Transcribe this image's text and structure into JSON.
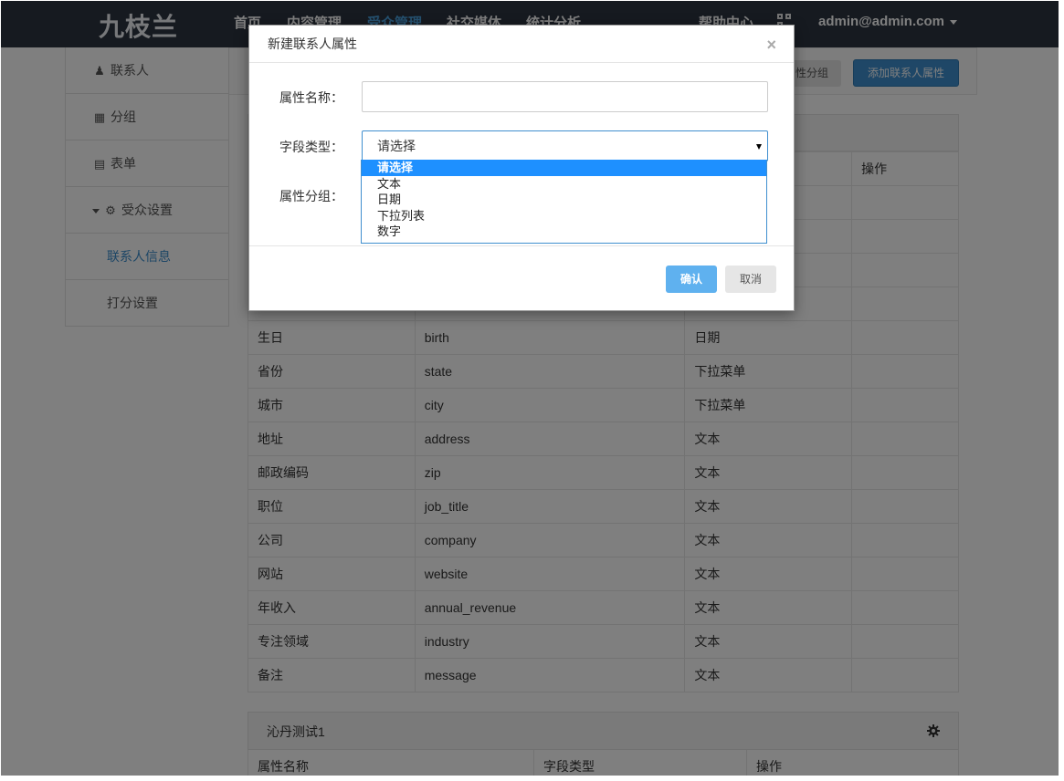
{
  "nav": {
    "logo": "九枝兰",
    "items": [
      "首页",
      "内容管理",
      "受众管理",
      "社交媒体",
      "统计分析"
    ],
    "help": "帮助中心",
    "user": "admin@admin.com"
  },
  "sidebar": {
    "contacts": "联系人",
    "groups": "分组",
    "forms": "表单",
    "audience_settings": "受众设置",
    "contact_info": "联系人信息",
    "scoring": "打分设置"
  },
  "toolbar": {
    "attr_group_partial": "性分组",
    "add_attr": "添加联系人属性"
  },
  "table": {
    "header_action": "操作",
    "rows": [
      [
        "生日",
        "birth",
        "日期"
      ],
      [
        "省份",
        "state",
        "下拉菜单"
      ],
      [
        "城市",
        "city",
        "下拉菜单"
      ],
      [
        "地址",
        "address",
        "文本"
      ],
      [
        "邮政编码",
        "zip",
        "文本"
      ],
      [
        "职位",
        "job_title",
        "文本"
      ],
      [
        "公司",
        "company",
        "文本"
      ],
      [
        "网站",
        "website",
        "文本"
      ],
      [
        "年收入",
        "annual_revenue",
        "文本"
      ],
      [
        "专注领域",
        "industry",
        "文本"
      ],
      [
        "备注",
        "message",
        "文本"
      ]
    ]
  },
  "panel2": {
    "title": "沁丹测试1",
    "columns": [
      "属性名称",
      "字段类型",
      "操作"
    ]
  },
  "modal": {
    "title": "新建联系人属性",
    "name_label": "属性名称：",
    "type_label": "字段类型：",
    "group_label": "属性分组：",
    "type_value": "请选择",
    "options": [
      "请选择",
      "文本",
      "日期",
      "下拉列表",
      "数字"
    ],
    "ok": "确认",
    "cancel": "取消",
    "close": "×"
  },
  "colors": {
    "nav_bg": "#2c3440",
    "accent": "#3f8fcf",
    "option_highlight": "#1e90ff"
  }
}
